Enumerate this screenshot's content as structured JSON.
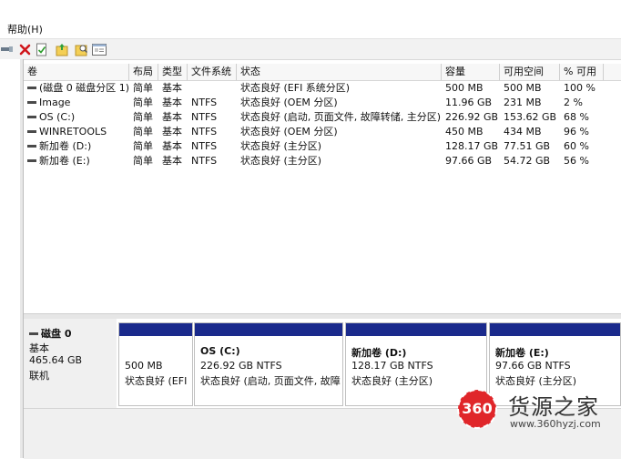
{
  "menu": {
    "help_label": "帮助(H)"
  },
  "toolbar": {
    "icons": [
      "connect-icon",
      "delete-icon",
      "check-icon",
      "folder-up-icon",
      "folder-search-icon",
      "properties-icon"
    ]
  },
  "volume_table": {
    "columns": [
      "卷",
      "布局",
      "类型",
      "文件系统",
      "状态",
      "容量",
      "可用空间",
      "% 可用"
    ],
    "rows": [
      {
        "volume": "(磁盘 0 磁盘分区 1)",
        "layout": "简单",
        "type": "基本",
        "fs": "",
        "status": "状态良好 (EFI 系统分区)",
        "capacity": "500 MB",
        "free": "500 MB",
        "pct": "100 %"
      },
      {
        "volume": "Image",
        "layout": "简单",
        "type": "基本",
        "fs": "NTFS",
        "status": "状态良好 (OEM 分区)",
        "capacity": "11.96 GB",
        "free": "231 MB",
        "pct": "2 %"
      },
      {
        "volume": "OS (C:)",
        "layout": "简单",
        "type": "基本",
        "fs": "NTFS",
        "status": "状态良好 (启动, 页面文件, 故障转储, 主分区)",
        "capacity": "226.92 GB",
        "free": "153.62 GB",
        "pct": "68 %"
      },
      {
        "volume": "WINRETOOLS",
        "layout": "简单",
        "type": "基本",
        "fs": "NTFS",
        "status": "状态良好 (OEM 分区)",
        "capacity": "450 MB",
        "free": "434 MB",
        "pct": "96 %"
      },
      {
        "volume": "新加卷 (D:)",
        "layout": "简单",
        "type": "基本",
        "fs": "NTFS",
        "status": "状态良好 (主分区)",
        "capacity": "128.17 GB",
        "free": "77.51 GB",
        "pct": "60 %"
      },
      {
        "volume": "新加卷 (E:)",
        "layout": "简单",
        "type": "基本",
        "fs": "NTFS",
        "status": "状态良好 (主分区)",
        "capacity": "97.66 GB",
        "free": "54.72 GB",
        "pct": "56 %"
      }
    ]
  },
  "disk": {
    "name": "磁盘 0",
    "kind": "基本",
    "size": "465.64 GB",
    "state": "联机",
    "partitions": [
      {
        "title": "",
        "size": "500 MB",
        "status": "状态良好 (EFI"
      },
      {
        "title": "OS  (C:)",
        "size": "226.92 GB NTFS",
        "status": "状态良好 (启动, 页面文件, 故障"
      },
      {
        "title": "新加卷  (D:)",
        "size": "128.17 GB NTFS",
        "status": "状态良好 (主分区)"
      },
      {
        "title": "新加卷  (E:)",
        "size": "97.66 GB NTFS",
        "status": "状态良好 (主分区)"
      }
    ]
  },
  "watermark": {
    "brand": "货源之家",
    "url": "www.360hyzj.com",
    "badge": "360"
  },
  "colors": {
    "partition_bar": "#1a2a8c",
    "badge_red": "#e0262a"
  }
}
